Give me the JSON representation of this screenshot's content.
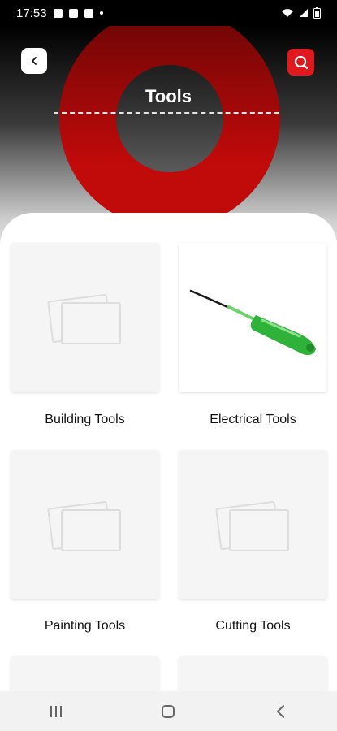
{
  "status_bar": {
    "time": "17:53",
    "notification_icons": [
      "image-icon",
      "bag-icon",
      "bag-icon"
    ],
    "system_icons": [
      "wifi-icon",
      "signal-icon",
      "battery-icon"
    ]
  },
  "header": {
    "title": "Tools",
    "back_icon": "chevron-left-icon",
    "search_icon": "search-icon",
    "accent_color": "#e0191e"
  },
  "categories": [
    {
      "label": "Building Tools",
      "image": "placeholder-image-icon"
    },
    {
      "label": "Electrical Tools",
      "image": "screwdriver-image"
    },
    {
      "label": "Painting Tools",
      "image": "placeholder-image-icon"
    },
    {
      "label": "Cutting Tools",
      "image": "placeholder-image-icon"
    }
  ],
  "nav_bar": {
    "buttons": [
      "recent-apps-icon",
      "home-icon",
      "back-icon"
    ]
  }
}
